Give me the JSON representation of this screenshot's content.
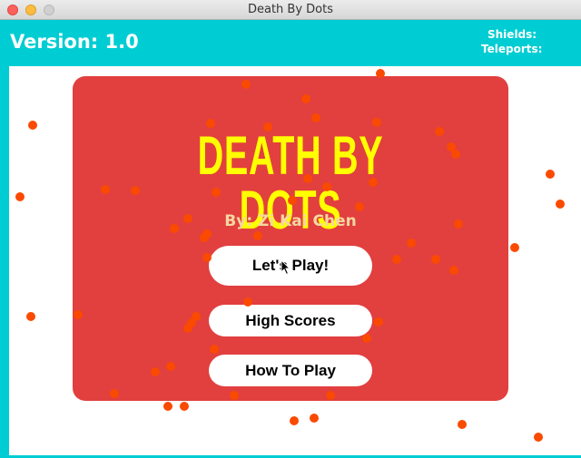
{
  "window": {
    "title": "Death By Dots"
  },
  "header": {
    "version_label": "Version: 1.0",
    "shields_label": "Shields:",
    "teleports_label": "Teleports:"
  },
  "menu": {
    "title": "DEATH BY DOTS",
    "author": "By: Zi Kai Chen",
    "play_label": "Let's Play!",
    "scores_label": "High Scores",
    "howto_label": "How To Play"
  },
  "colors": {
    "header": "#00cdd3",
    "panel": "#e23f3f",
    "title": "#ffff00",
    "dot": "#fa4a00"
  }
}
